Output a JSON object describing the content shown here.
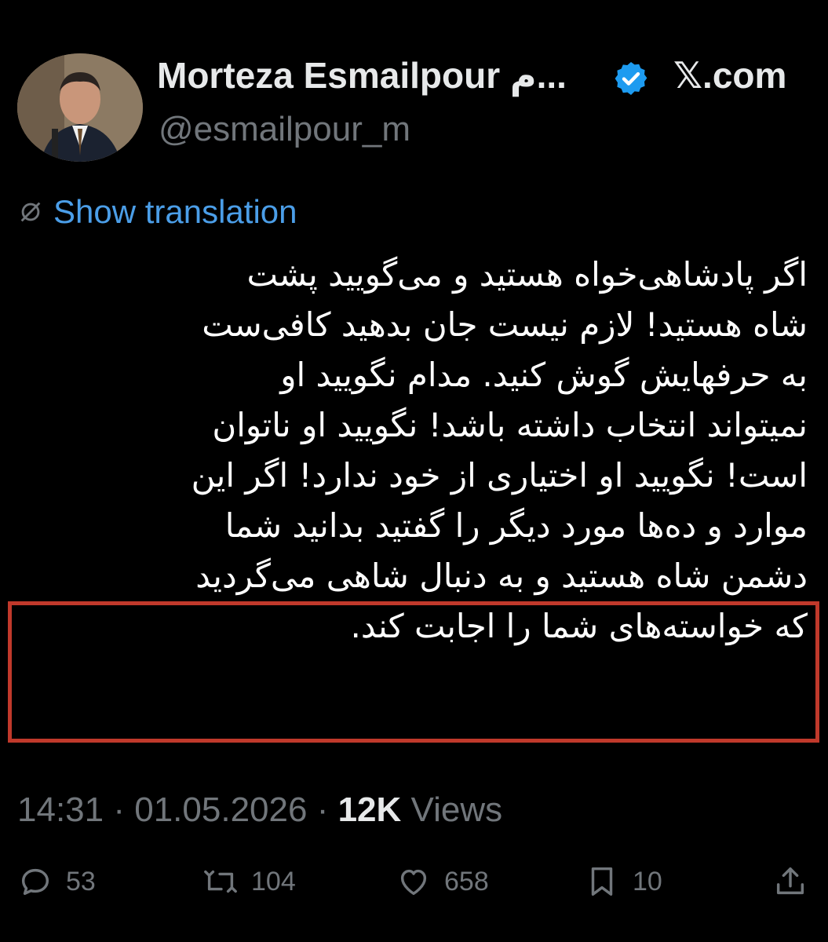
{
  "author": {
    "name": "Morteza Esmailpour م...",
    "handle": "@esmailpour_m",
    "verified_color": "#1d9bf0"
  },
  "source": "𝕏.com",
  "translation_link": "Show translation",
  "tweet_lines": [
    "اگر پادشاهی‌خواه هستید و می‌گویید پشت",
    "شاه هستید! لازم نیست جان بدهید کافی‌ست",
    "به حرفهایش گوش کنید. مدام نگویید او",
    "نمیتواند انتخاب داشته باشد! نگویید او ناتوان",
    "است! نگویید او اختیاری از خود ندارد! اگر این",
    "موارد و ده‌ها مورد دیگر را گفتید بدانید شما",
    "دشمن شاه هستید و به دنبال شاهی می‌گردید",
    "که خواسته‌های شما را اجابت کند."
  ],
  "highlight_color": "#c0392b",
  "meta": {
    "time": "14:31",
    "date": "01.05.2026",
    "views_count": "12K",
    "views_label": "Views"
  },
  "actions": {
    "replies": "53",
    "reposts": "104",
    "likes": "658",
    "bookmarks": "10"
  }
}
